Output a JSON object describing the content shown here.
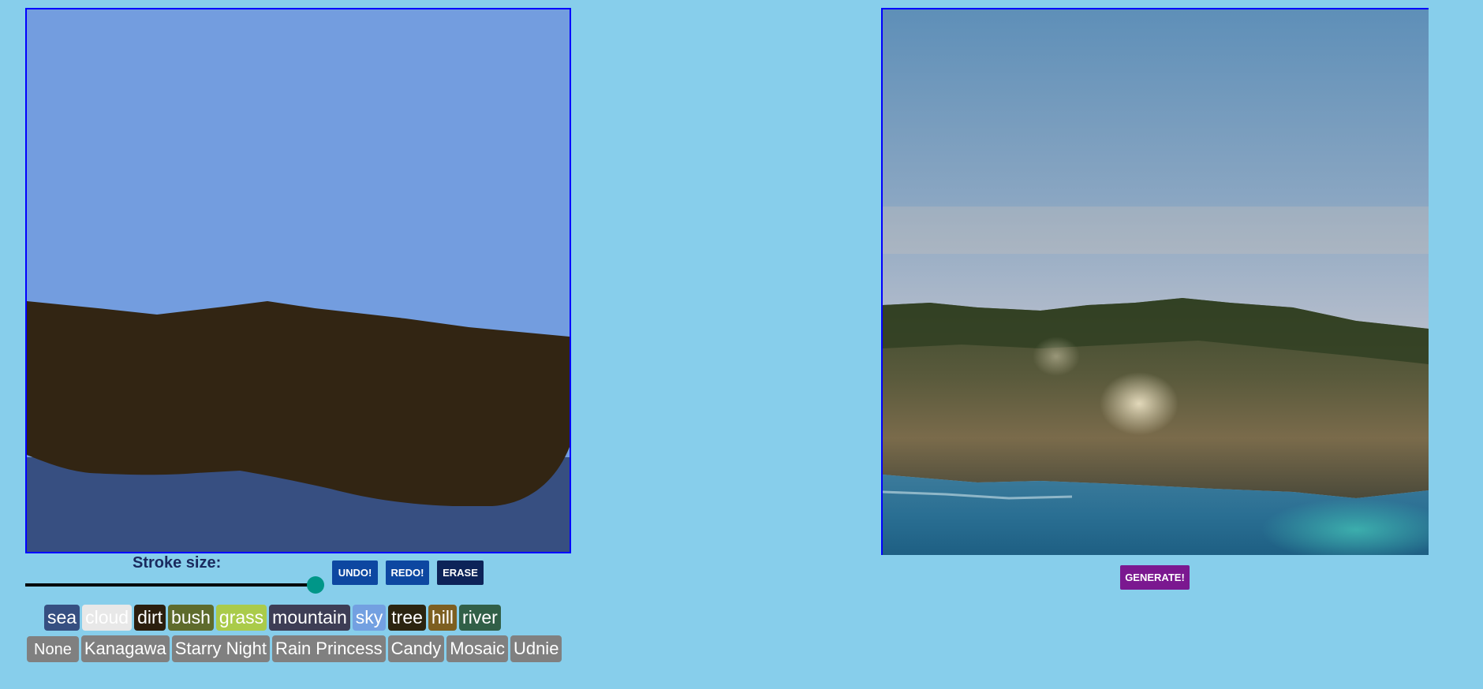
{
  "drawing_canvas": {
    "sky_color": "#739ddf",
    "dirt_color": "#322513",
    "sea_color": "#374f81"
  },
  "output_image": {
    "sky_top": "#5e8fb8",
    "sky_mid": "#a7b8cc",
    "cliff_color": "#4e553a",
    "water_color": "#2a6f93"
  },
  "controls": {
    "stroke_label": "Stroke size:",
    "stroke_value_fraction": 0.98,
    "undo_label": "UNDO!",
    "redo_label": "REDO!",
    "erase_label": "ERASE",
    "generate_label": "GENERATE!"
  },
  "labels": [
    {
      "name": "sea",
      "text": "sea",
      "color": "#364f81"
    },
    {
      "name": "cloud",
      "text": "cloud",
      "color": "#e8e8e8"
    },
    {
      "name": "dirt",
      "text": "dirt",
      "color": "#2b1e0e"
    },
    {
      "name": "bush",
      "text": "bush",
      "color": "#5e6b2c"
    },
    {
      "name": "grass",
      "text": "grass",
      "color": "#aacb4a"
    },
    {
      "name": "mountain",
      "text": "mountain",
      "color": "#3d3d55"
    },
    {
      "name": "sky",
      "text": "sky",
      "color": "#73a0e1"
    },
    {
      "name": "tree",
      "text": "tree",
      "color": "#2b2410"
    },
    {
      "name": "hill",
      "text": "hill",
      "color": "#7d5f21"
    },
    {
      "name": "river",
      "text": "river",
      "color": "#315f47"
    }
  ],
  "styles": [
    {
      "name": "none",
      "text": "None",
      "selected": true
    },
    {
      "name": "kanagawa",
      "text": "Kanagawa"
    },
    {
      "name": "starry-night",
      "text": "Starry Night"
    },
    {
      "name": "rain-princess",
      "text": "Rain Princess"
    },
    {
      "name": "candy",
      "text": "Candy"
    },
    {
      "name": "mosaic",
      "text": "Mosaic"
    },
    {
      "name": "udnie",
      "text": "Udnie"
    }
  ]
}
